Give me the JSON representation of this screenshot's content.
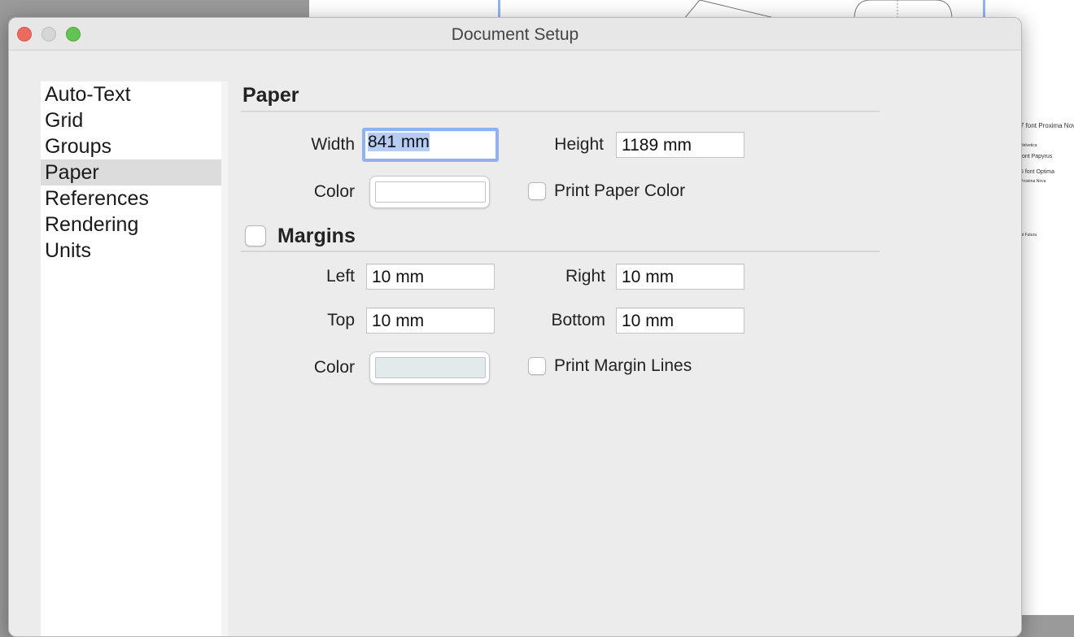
{
  "background_document": {
    "text_lines": [
      "7 font Proxima Nova",
      "Helvetica",
      "font Papyrus",
      "6 font Optima",
      "Proxima Nova",
      "nt Futura"
    ]
  },
  "window": {
    "title": "Document Setup"
  },
  "sidebar": {
    "items": [
      {
        "label": "Auto-Text",
        "selected": false
      },
      {
        "label": "Grid",
        "selected": false
      },
      {
        "label": "Groups",
        "selected": false
      },
      {
        "label": "Paper",
        "selected": true
      },
      {
        "label": "References",
        "selected": false
      },
      {
        "label": "Rendering",
        "selected": false
      },
      {
        "label": "Units",
        "selected": false
      }
    ]
  },
  "paper": {
    "section_title": "Paper",
    "width_label": "Width",
    "width_value": "841 mm",
    "height_label": "Height",
    "height_value": "1189 mm",
    "color_label": "Color",
    "color_value": "#ffffff",
    "print_color_label": "Print Paper Color",
    "print_color_checked": false
  },
  "margins": {
    "section_title": "Margins",
    "enabled": false,
    "left_label": "Left",
    "left_value": "10 mm",
    "right_label": "Right",
    "right_value": "10 mm",
    "top_label": "Top",
    "top_value": "10 mm",
    "bottom_label": "Bottom",
    "bottom_value": "10 mm",
    "color_label": "Color",
    "color_value": "#e3eaec",
    "print_lines_label": "Print Margin Lines",
    "print_lines_checked": false
  },
  "colors": {
    "close": "#ed6a5e",
    "minimize": "#d6d6d6",
    "zoom": "#61c454",
    "selection": "#b5cdf5",
    "focus_ring": "#8eb2f3"
  }
}
